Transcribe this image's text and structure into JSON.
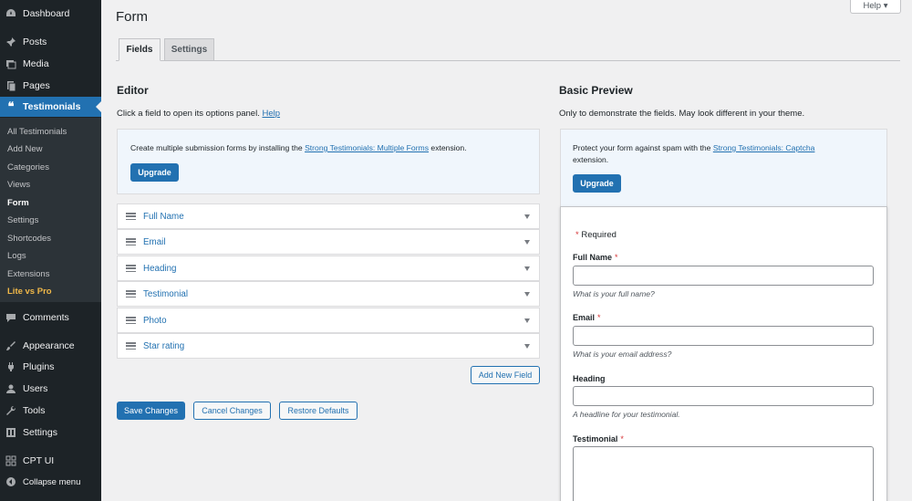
{
  "sidebar": {
    "items": [
      {
        "label": "Dashboard",
        "icon": "dashboard-icon"
      },
      {
        "label": "Posts",
        "icon": "pin-icon"
      },
      {
        "label": "Media",
        "icon": "media-icon"
      },
      {
        "label": "Pages",
        "icon": "pages-icon"
      },
      {
        "label": "Testimonials",
        "icon": "quote-icon"
      },
      {
        "label": "Comments",
        "icon": "comment-icon"
      },
      {
        "label": "Appearance",
        "icon": "brush-icon"
      },
      {
        "label": "Plugins",
        "icon": "plug-icon"
      },
      {
        "label": "Users",
        "icon": "user-icon"
      },
      {
        "label": "Tools",
        "icon": "wrench-icon"
      },
      {
        "label": "Settings",
        "icon": "settings-icon"
      },
      {
        "label": "CPT UI",
        "icon": "grid-icon"
      },
      {
        "label": "Collapse menu",
        "icon": "collapse-icon"
      }
    ],
    "submenu": [
      "All Testimonials",
      "Add New",
      "Categories",
      "Views",
      "Form",
      "Settings",
      "Shortcodes",
      "Logs",
      "Extensions",
      "Lite vs Pro"
    ]
  },
  "header": {
    "help_label": "Help ▾",
    "title": "Form"
  },
  "tabs": [
    {
      "label": "Fields"
    },
    {
      "label": "Settings"
    }
  ],
  "editor": {
    "title": "Editor",
    "desc": "Click a field to open its options panel.",
    "help_link": "Help",
    "notice_pre": "Create multiple submission forms by installing the ",
    "notice_link": "Strong Testimonials: Multiple Forms",
    "notice_post": " extension.",
    "upgrade_label": "Upgrade",
    "fields": [
      "Full Name",
      "Email",
      "Heading",
      "Testimonial",
      "Photo",
      "Star rating"
    ],
    "add_new_label": "Add New Field",
    "save_label": "Save Changes",
    "cancel_label": "Cancel Changes",
    "restore_label": "Restore Defaults"
  },
  "preview": {
    "title": "Basic Preview",
    "desc": "Only to demonstrate the fields. May look different in your theme.",
    "notice_pre": "Protect your form against spam with the ",
    "notice_link": "Strong Testimonials: Captcha",
    "notice_post": "extension.",
    "upgrade_label": "Upgrade",
    "required_star": "*",
    "required_label": "Required",
    "fields": [
      {
        "label": "Full Name",
        "required": "*",
        "hint": "What is your full name?"
      },
      {
        "label": "Email",
        "required": "*",
        "hint": "What is your email address?"
      },
      {
        "label": "Heading",
        "required": "",
        "hint": "A headline for your testimonial."
      },
      {
        "label": "Testimonial",
        "required": "*",
        "hint": ""
      }
    ]
  },
  "colors": {
    "accent": "#2271b1",
    "sidebar_bg": "#1d2327",
    "required": "#d63638",
    "pro_highlight": "#f0b849"
  }
}
